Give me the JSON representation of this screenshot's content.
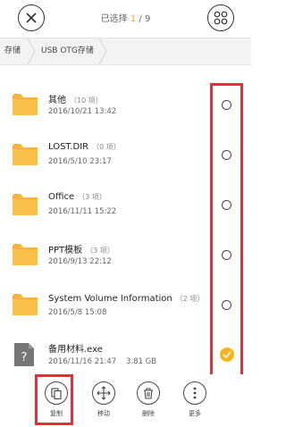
{
  "header": {
    "title_prefix": "已选择",
    "selected_count": "1",
    "total": "/ 9"
  },
  "breadcrumb": [
    "存储",
    "USB OTG存储"
  ],
  "files": [
    {
      "name": "其他",
      "count": "（10 项）",
      "meta": "2016/10/21 13:42",
      "type": "folder",
      "selected": false
    },
    {
      "name": "LOST.DIR",
      "count": "（0 项）",
      "meta": "2016/5/10 23:17",
      "type": "folder",
      "selected": false
    },
    {
      "name": "Office",
      "count": "（3 项）",
      "meta": "2016/11/11 15:22",
      "type": "folder",
      "selected": false
    },
    {
      "name": "PPT模板",
      "count": "（3 项）",
      "meta": "2016/9/13 22:12",
      "type": "folder",
      "selected": false
    },
    {
      "name": "System Volume Information",
      "count": "（2 项）",
      "meta": "2016/5/8 15:08",
      "type": "folder",
      "selected": false
    },
    {
      "name": "备用材料.exe",
      "count": "",
      "meta": "2016/11/16 21:47    3.81 GB",
      "type": "file",
      "selected": true
    }
  ],
  "toolbar": [
    {
      "label": "复制",
      "icon": "copy-icon"
    },
    {
      "label": "移动",
      "icon": "move-icon"
    },
    {
      "label": "删除",
      "icon": "trash-icon"
    },
    {
      "label": "更多",
      "icon": "more-icon"
    }
  ],
  "colors": {
    "accent": "#f5a623",
    "highlight": "#ee2a36",
    "folder": "#f6b53a"
  }
}
